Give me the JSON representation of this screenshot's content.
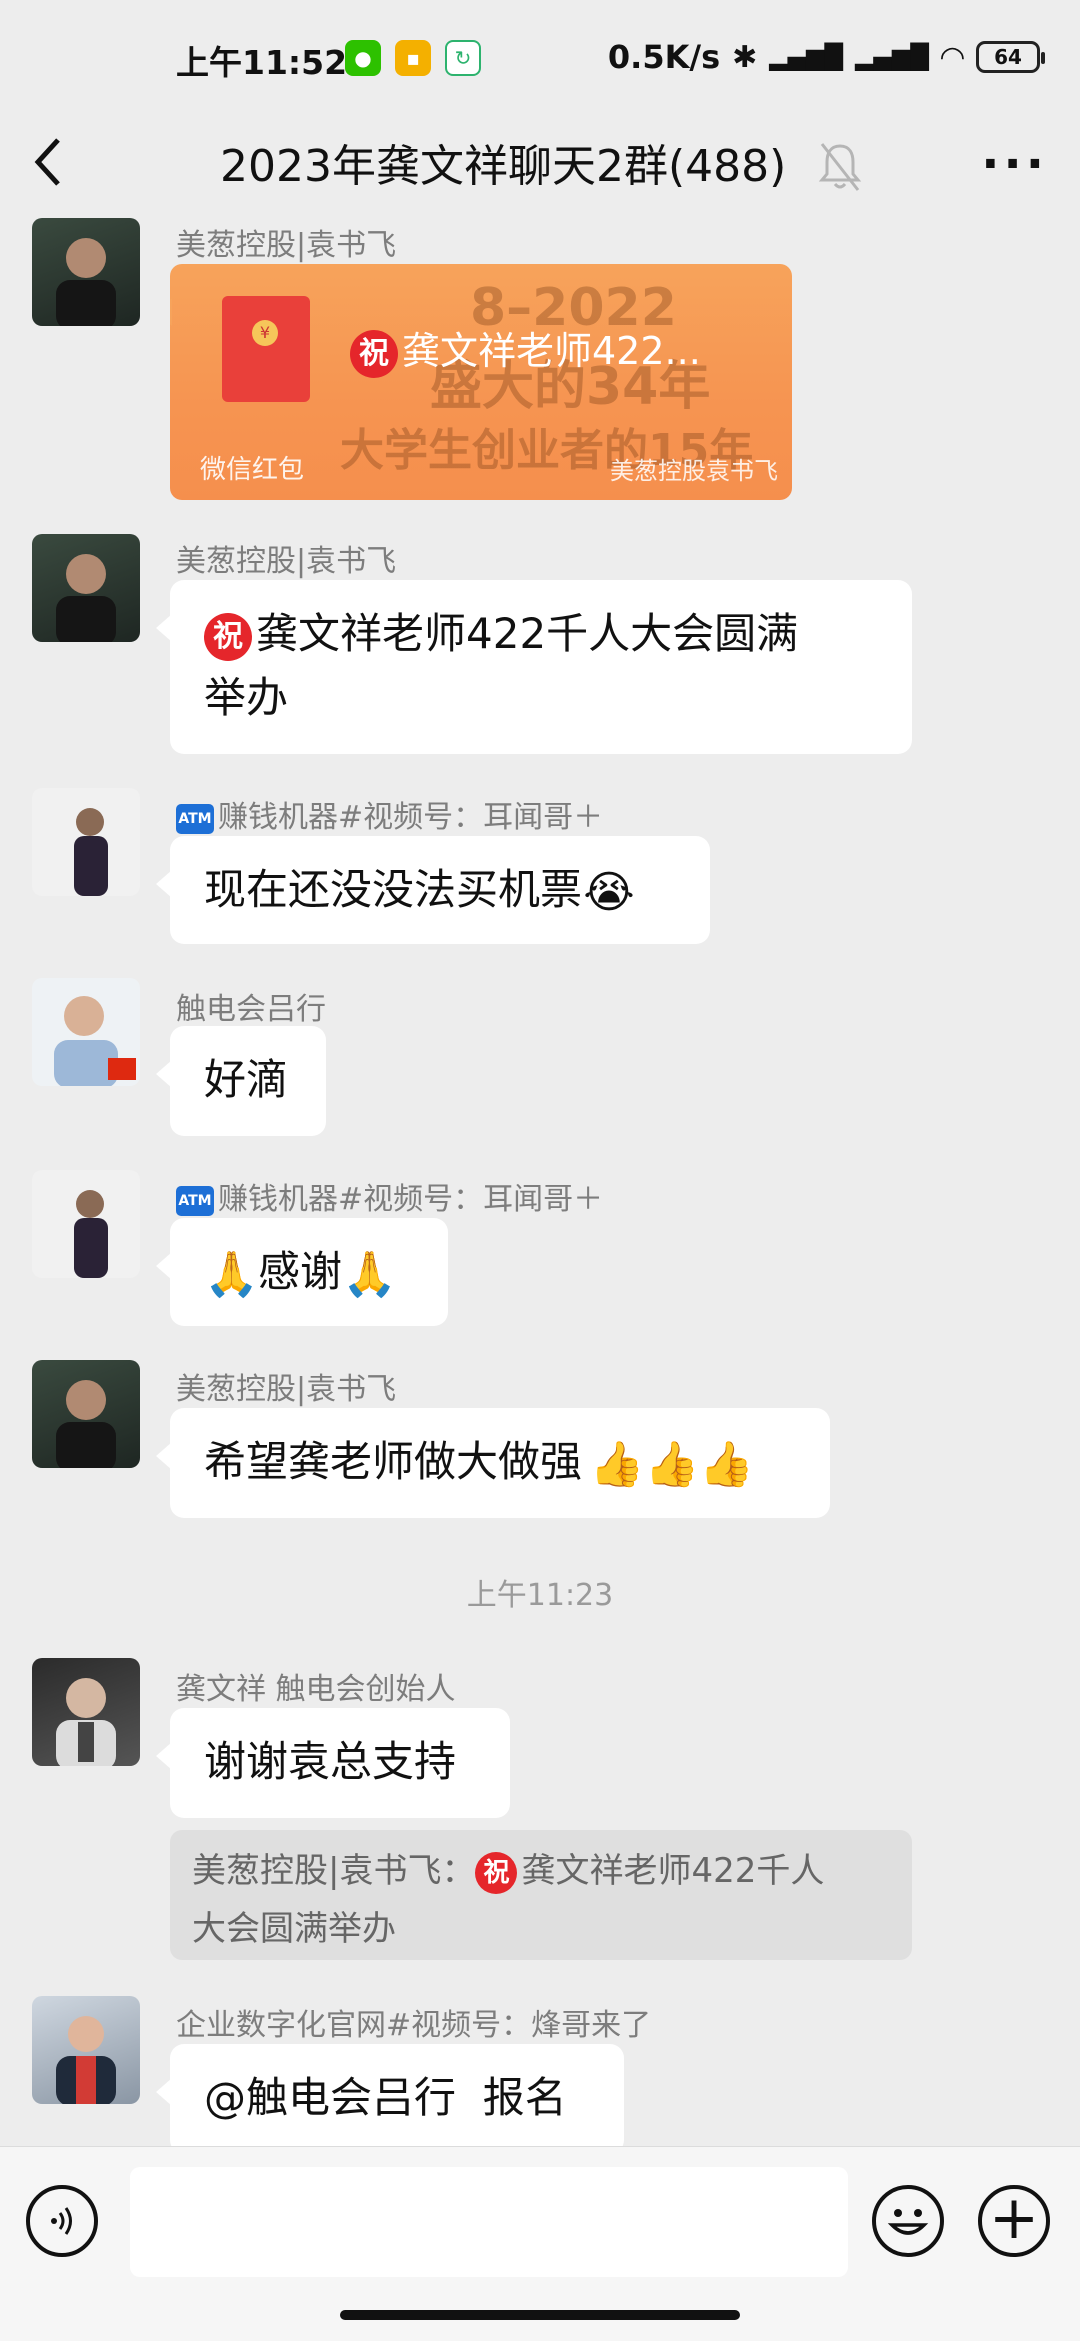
{
  "status_bar": {
    "time": "上午11:52",
    "net_speed": "0.5K/s",
    "battery": "64",
    "icons": [
      "wechat-icon",
      "notes-icon",
      "sync-icon",
      "bluetooth-icon",
      "hd-signal-icon",
      "hd-signal-icon",
      "wifi-icon",
      "battery-icon"
    ]
  },
  "header": {
    "title": "2023年龚文祥聊天2群(488)",
    "back_icon": "back-arrow-icon",
    "mute_icon": "mute-bell-icon",
    "more_label": "···"
  },
  "messages": [
    {
      "sender": "美葱控股|袁书飞",
      "type": "red_packet",
      "red_packet": {
        "badge": "祝",
        "title": "龚文祥老师422...",
        "label": "微信红包",
        "footer": "美葱控股袁书飞",
        "bg_lines": [
          "8–2022",
          "盛大的34年",
          "大学生创业者的15年"
        ]
      }
    },
    {
      "sender": "美葱控股|袁书飞",
      "badge": "祝",
      "text_line1": "龚文祥老师422千人大会圆满",
      "text_line2": "举办"
    },
    {
      "sender_badge": "ATM",
      "sender": "赚钱机器#视频号：耳闻哥＋",
      "text": "现在还没没法买机票",
      "emoji": "😭"
    },
    {
      "sender": "触电会吕行",
      "text": "好滴"
    },
    {
      "sender_badge": "ATM",
      "sender": "赚钱机器#视频号：耳闻哥＋",
      "emoji_before": "🙏",
      "text": "感谢",
      "emoji_after": "🙏"
    },
    {
      "sender": "美葱控股|袁书飞",
      "text": "希望龚老师做大做强",
      "emoji": "👍👍👍"
    },
    {
      "timestamp": "上午11:23"
    },
    {
      "sender": "龚文祥 触电会创始人",
      "text": "谢谢袁总支持",
      "quote_prefix": "美葱控股|袁书飞：",
      "quote_badge": "祝",
      "quote_line1": "龚文祥老师422千人",
      "quote_line2": "大会圆满举办"
    },
    {
      "sender": "企业数字化官网#视频号：烽哥来了",
      "text": "@触电会吕行  报名"
    }
  ],
  "input_bar": {
    "voice_icon": "voice-icon",
    "emoji_icon": "emoji-icon",
    "plus_label": "+"
  }
}
